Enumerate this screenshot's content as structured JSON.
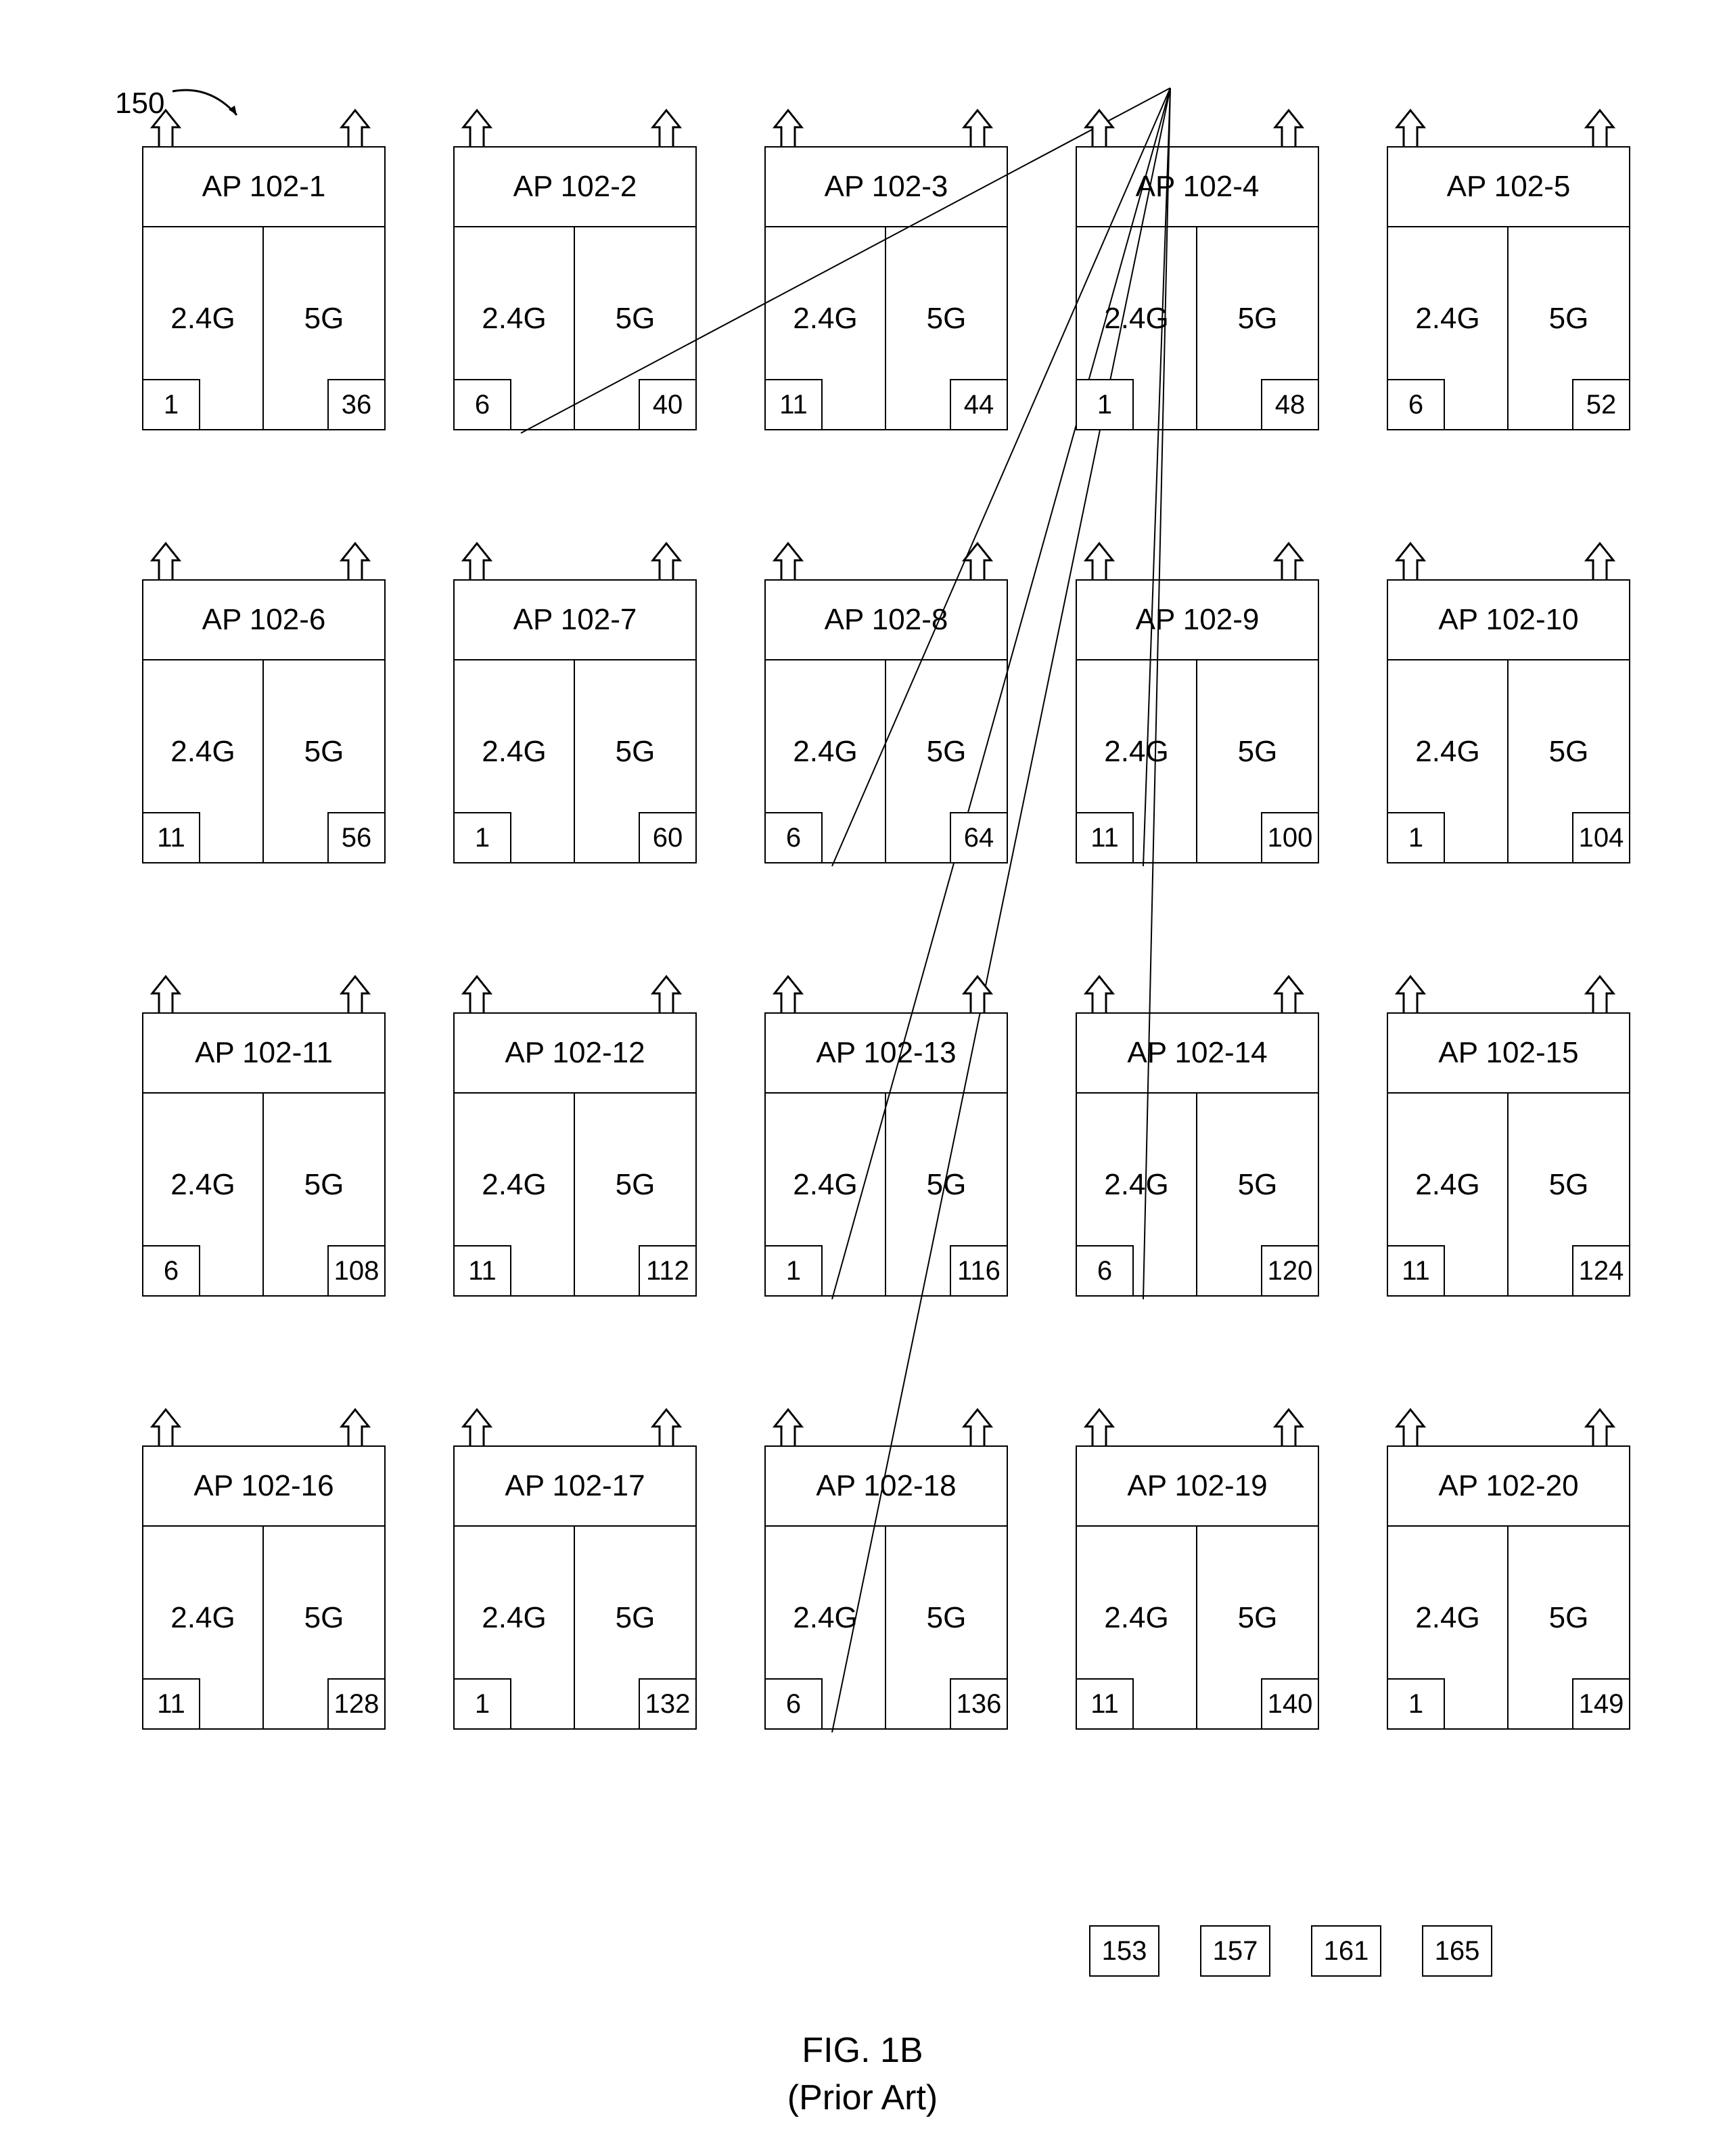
{
  "ref_label": "150",
  "band24_label": "2.4G",
  "band5_label": "5G",
  "aps": [
    {
      "id": "AP 102-1",
      "ch24": "1",
      "ch5": "36"
    },
    {
      "id": "AP 102-2",
      "ch24": "6",
      "ch5": "40"
    },
    {
      "id": "AP 102-3",
      "ch24": "11",
      "ch5": "44"
    },
    {
      "id": "AP 102-4",
      "ch24": "1",
      "ch5": "48"
    },
    {
      "id": "AP 102-5",
      "ch24": "6",
      "ch5": "52"
    },
    {
      "id": "AP 102-6",
      "ch24": "11",
      "ch5": "56"
    },
    {
      "id": "AP 102-7",
      "ch24": "1",
      "ch5": "60"
    },
    {
      "id": "AP 102-8",
      "ch24": "6",
      "ch5": "64"
    },
    {
      "id": "AP 102-9",
      "ch24": "11",
      "ch5": "100"
    },
    {
      "id": "AP 102-10",
      "ch24": "1",
      "ch5": "104"
    },
    {
      "id": "AP 102-11",
      "ch24": "6",
      "ch5": "108"
    },
    {
      "id": "AP 102-12",
      "ch24": "11",
      "ch5": "112"
    },
    {
      "id": "AP 102-13",
      "ch24": "1",
      "ch5": "116"
    },
    {
      "id": "AP 102-14",
      "ch24": "6",
      "ch5": "120"
    },
    {
      "id": "AP 102-15",
      "ch24": "11",
      "ch5": "124"
    },
    {
      "id": "AP 102-16",
      "ch24": "11",
      "ch5": "128"
    },
    {
      "id": "AP 102-17",
      "ch24": "1",
      "ch5": "132"
    },
    {
      "id": "AP 102-18",
      "ch24": "6",
      "ch5": "136"
    },
    {
      "id": "AP 102-19",
      "ch24": "11",
      "ch5": "140"
    },
    {
      "id": "AP 102-20",
      "ch24": "1",
      "ch5": "149"
    }
  ],
  "extra_channels": [
    "153",
    "157",
    "161",
    "165"
  ],
  "figure_label": "FIG. 1B",
  "figure_sub": "(Prior Art)",
  "signal_origin_note": "lines fan from a point above AP 102-4 to APs 2,8,9,13,14,18"
}
